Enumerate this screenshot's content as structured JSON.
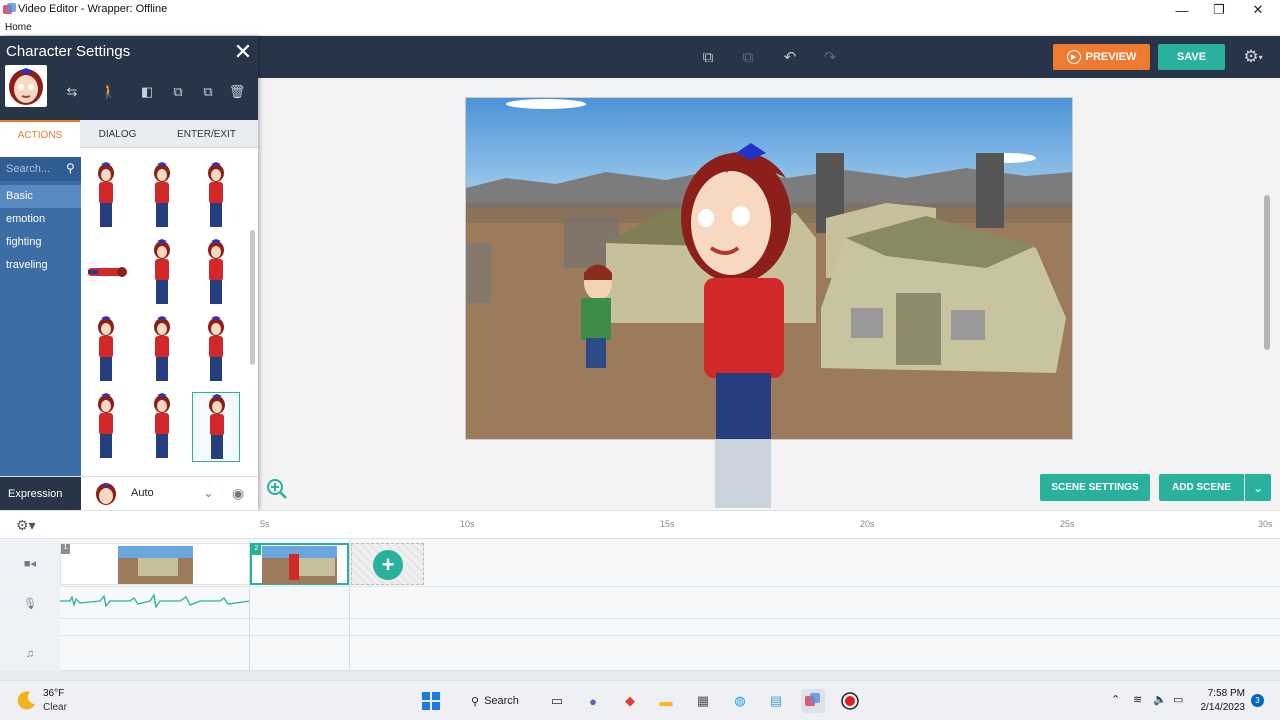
{
  "window": {
    "title": "Video Editor - Wrapper: Offline",
    "menu": "Home"
  },
  "toolbar": {
    "preview_label": "PREVIEW",
    "save_label": "SAVE"
  },
  "character_panel": {
    "title": "Character Settings",
    "tabs": [
      {
        "label": "ACTIONS",
        "active": true
      },
      {
        "label": "DIALOG"
      },
      {
        "label": "ENTER/EXIT"
      }
    ],
    "search_placeholder": "Search...",
    "categories": [
      {
        "label": "Basic",
        "active": true
      },
      {
        "label": "emotion"
      },
      {
        "label": "fighting"
      },
      {
        "label": "traveling"
      }
    ],
    "expression_label": "Expression",
    "expression_value": "Auto"
  },
  "stage": {
    "scene_settings_label": "SCENE SETTINGS",
    "add_scene_label": "ADD SCENE"
  },
  "timeline": {
    "ticks": [
      "5s",
      "10s",
      "15s",
      "20s",
      "25s",
      "30s"
    ],
    "scenes": [
      {
        "num": "1"
      },
      {
        "num": "2",
        "selected": true
      }
    ]
  },
  "taskbar": {
    "temperature": "36°F",
    "weather": "Clear",
    "search_label": "Search",
    "time": "7:58 PM",
    "date": "2/14/2023",
    "notifications": "3"
  },
  "colors": {
    "accent": "#29b19d",
    "preview": "#ef7b31",
    "navbar": "#283548"
  }
}
